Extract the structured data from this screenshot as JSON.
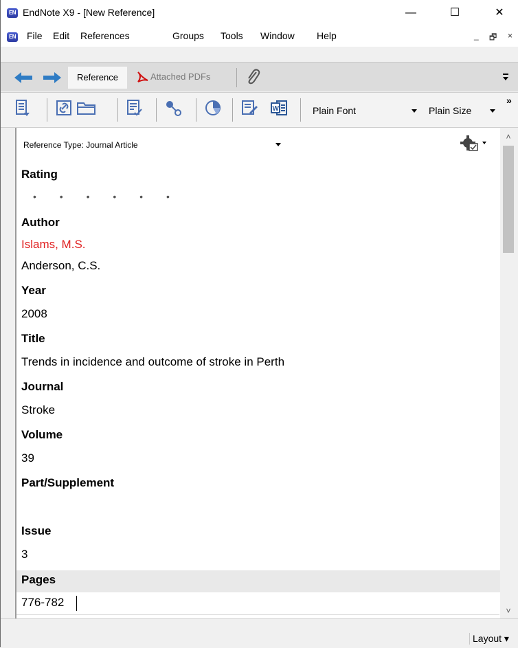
{
  "window": {
    "badge": "EN",
    "title": "EndNote X9 - [New Reference]",
    "controls": {
      "minimize": "—",
      "maximize": "☐",
      "close": "✕"
    }
  },
  "menu": {
    "items": [
      "File",
      "Edit",
      "References",
      "Groups",
      "Tools",
      "Window",
      "Help"
    ],
    "mdi": {
      "minimize": "_",
      "restore": "🗗",
      "close": "×"
    }
  },
  "tabs": {
    "reference": "Reference",
    "attached_pdfs": "Attached PDFs"
  },
  "toolbar": {
    "font": "Plain Font",
    "size": "Plain Size",
    "overflow": "»"
  },
  "editor": {
    "reference_type_label": "Reference Type:",
    "reference_type_value": "Journal Article",
    "fields": [
      {
        "label": "Rating",
        "values": []
      },
      {
        "label": "Author",
        "values": [
          "Islams, M.S.",
          "Anderson, C.S."
        ]
      },
      {
        "label": "Year",
        "values": [
          "2008"
        ]
      },
      {
        "label": "Title",
        "values": [
          "Trends in incidence and outcome of stroke in Perth"
        ]
      },
      {
        "label": "Journal",
        "values": [
          "Stroke"
        ]
      },
      {
        "label": "Volume",
        "values": [
          "39"
        ]
      },
      {
        "label": "Part/Supplement",
        "values": []
      },
      {
        "label": "Issue",
        "values": [
          "3"
        ]
      },
      {
        "label": "Pages",
        "values": [
          "776-782"
        ]
      }
    ],
    "rating_dots": "• • • • • •"
  },
  "status": {
    "layout": "Layout"
  },
  "colors": {
    "unmatched_author": "#e02020",
    "accent_blue": "#2f63b6"
  }
}
